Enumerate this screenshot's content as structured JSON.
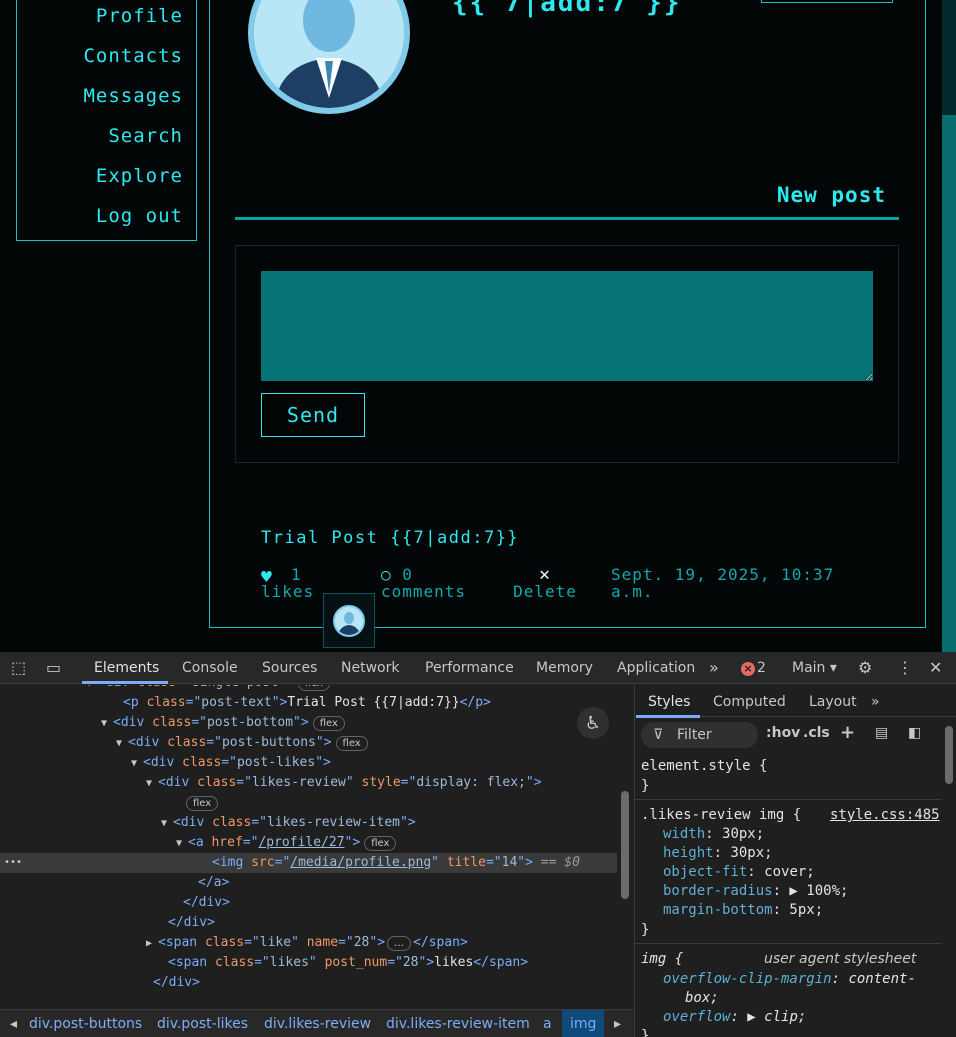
{
  "nav": {
    "items": [
      {
        "label": "Profile"
      },
      {
        "label": "Contacts"
      },
      {
        "label": "Messages"
      },
      {
        "label": "Search"
      },
      {
        "label": "Explore"
      },
      {
        "label": "Log out"
      }
    ]
  },
  "profile": {
    "title_partial": "{{ 7|add:7 }}"
  },
  "new_post": {
    "heading": "New post",
    "textarea_value": "",
    "send_label": "Send"
  },
  "post": {
    "text": "Trial Post {{7|add:7}}",
    "likes_count": "1",
    "likes_label": "likes",
    "comments_count": "0",
    "comments_label": "comments",
    "delete_label": "Delete",
    "timestamp_line1": "Sept. 19, 2025, 10:37",
    "timestamp_line2": "a.m.",
    "liker_title": "14"
  },
  "devtools": {
    "tabs": [
      "Elements",
      "Console",
      "Sources",
      "Network",
      "Performance",
      "Memory",
      "Application"
    ],
    "active_tab": "Elements",
    "error_count": "2",
    "context": "Main",
    "dom_lines": [
      {
        "indent": 98,
        "tri": "▼",
        "open": "<div",
        "attrs": [
          [
            "class",
            "single-post"
          ]
        ],
        "close": ">",
        "pill": "flex"
      },
      {
        "indent": 123,
        "tri": "",
        "open": "<p",
        "attrs": [
          [
            "class",
            "post-text"
          ]
        ],
        "close": ">",
        "text": "Trial Post {{7|add:7}}",
        "end": "</p>"
      },
      {
        "indent": 113,
        "tri": "▼",
        "open": "<div",
        "attrs": [
          [
            "class",
            "post-bottom"
          ]
        ],
        "close": ">",
        "pill": "flex"
      },
      {
        "indent": 128,
        "tri": "▼",
        "open": "<div",
        "attrs": [
          [
            "class",
            "post-buttons"
          ]
        ],
        "close": ">",
        "pill": "flex"
      },
      {
        "indent": 143,
        "tri": "▼",
        "open": "<div",
        "attrs": [
          [
            "class",
            "post-likes"
          ]
        ],
        "close": ">"
      },
      {
        "indent": 158,
        "tri": "▼",
        "open": "<div",
        "attrs": [
          [
            "class",
            "likes-review"
          ],
          [
            "style",
            "display: flex;"
          ]
        ],
        "close": ">"
      },
      {
        "indent": 182,
        "tri": "",
        "pill_only": "flex"
      },
      {
        "indent": 173,
        "tri": "▼",
        "open": "<div",
        "attrs": [
          [
            "class",
            "likes-review-item"
          ]
        ],
        "close": ">"
      },
      {
        "indent": 188,
        "tri": "▼",
        "open": "<a",
        "attrs": [
          [
            "href",
            "/profile/27"
          ]
        ],
        "close": ">",
        "pill": "flex"
      },
      {
        "indent": 212,
        "tri": "",
        "open": "<img",
        "attrs": [
          [
            "src",
            "/media/profile.png"
          ],
          [
            "title",
            "14"
          ]
        ],
        "close": ">",
        "suffix": " == $0",
        "selected": true
      },
      {
        "indent": 198,
        "tri": "",
        "end": "</a>"
      },
      {
        "indent": 183,
        "tri": "",
        "end": "</div>"
      },
      {
        "indent": 168,
        "tri": "",
        "end": "</div>"
      },
      {
        "indent": 158,
        "tri": "▶",
        "open": "<span",
        "attrs": [
          [
            "class",
            "like"
          ],
          [
            "name",
            "28"
          ]
        ],
        "close": ">",
        "ellipsis": "…",
        "end": "</span>"
      },
      {
        "indent": 168,
        "tri": "",
        "open": "<span",
        "attrs": [
          [
            "class",
            "likes"
          ],
          [
            "post_num",
            "28"
          ]
        ],
        "close": ">",
        "text": "likes",
        "end": "</span>"
      },
      {
        "indent": 153,
        "tri": "",
        "end": "</div>"
      }
    ],
    "breadcrumbs": [
      "div.post-buttons",
      "div.post-likes",
      "div.likes-review",
      "div.likes-review-item",
      "a",
      "img"
    ],
    "styles": {
      "tabs": [
        "Styles",
        "Computed",
        "Layout"
      ],
      "filter_placeholder": "Filter",
      "hov": ":hov",
      "cls": ".cls",
      "element_style": "element.style {",
      "close_brace": "}",
      "rule1_selector": ".likes-review img {",
      "rule1_source": "style.css:485",
      "rule1_props": [
        [
          "width",
          "30px;"
        ],
        [
          "height",
          "30px;"
        ],
        [
          "object-fit",
          "cover;"
        ],
        [
          "border-radius",
          "▶ 100%;"
        ],
        [
          "margin-bottom",
          "5px;"
        ]
      ],
      "rule2_selector": "img {",
      "rule2_source": "user agent stylesheet",
      "rule2_prop1_name": "overflow-clip-margin",
      "rule2_prop1_val_a": "content-",
      "rule2_prop1_val_b": "box;",
      "rule2_prop2_name": "overflow",
      "rule2_prop2_val": "▶ clip;"
    }
  },
  "colors": {
    "accent": "#2ee8f0",
    "border": "#14c3c7",
    "textarea": "#067377",
    "devtools_bg": "#1f1f1f"
  }
}
